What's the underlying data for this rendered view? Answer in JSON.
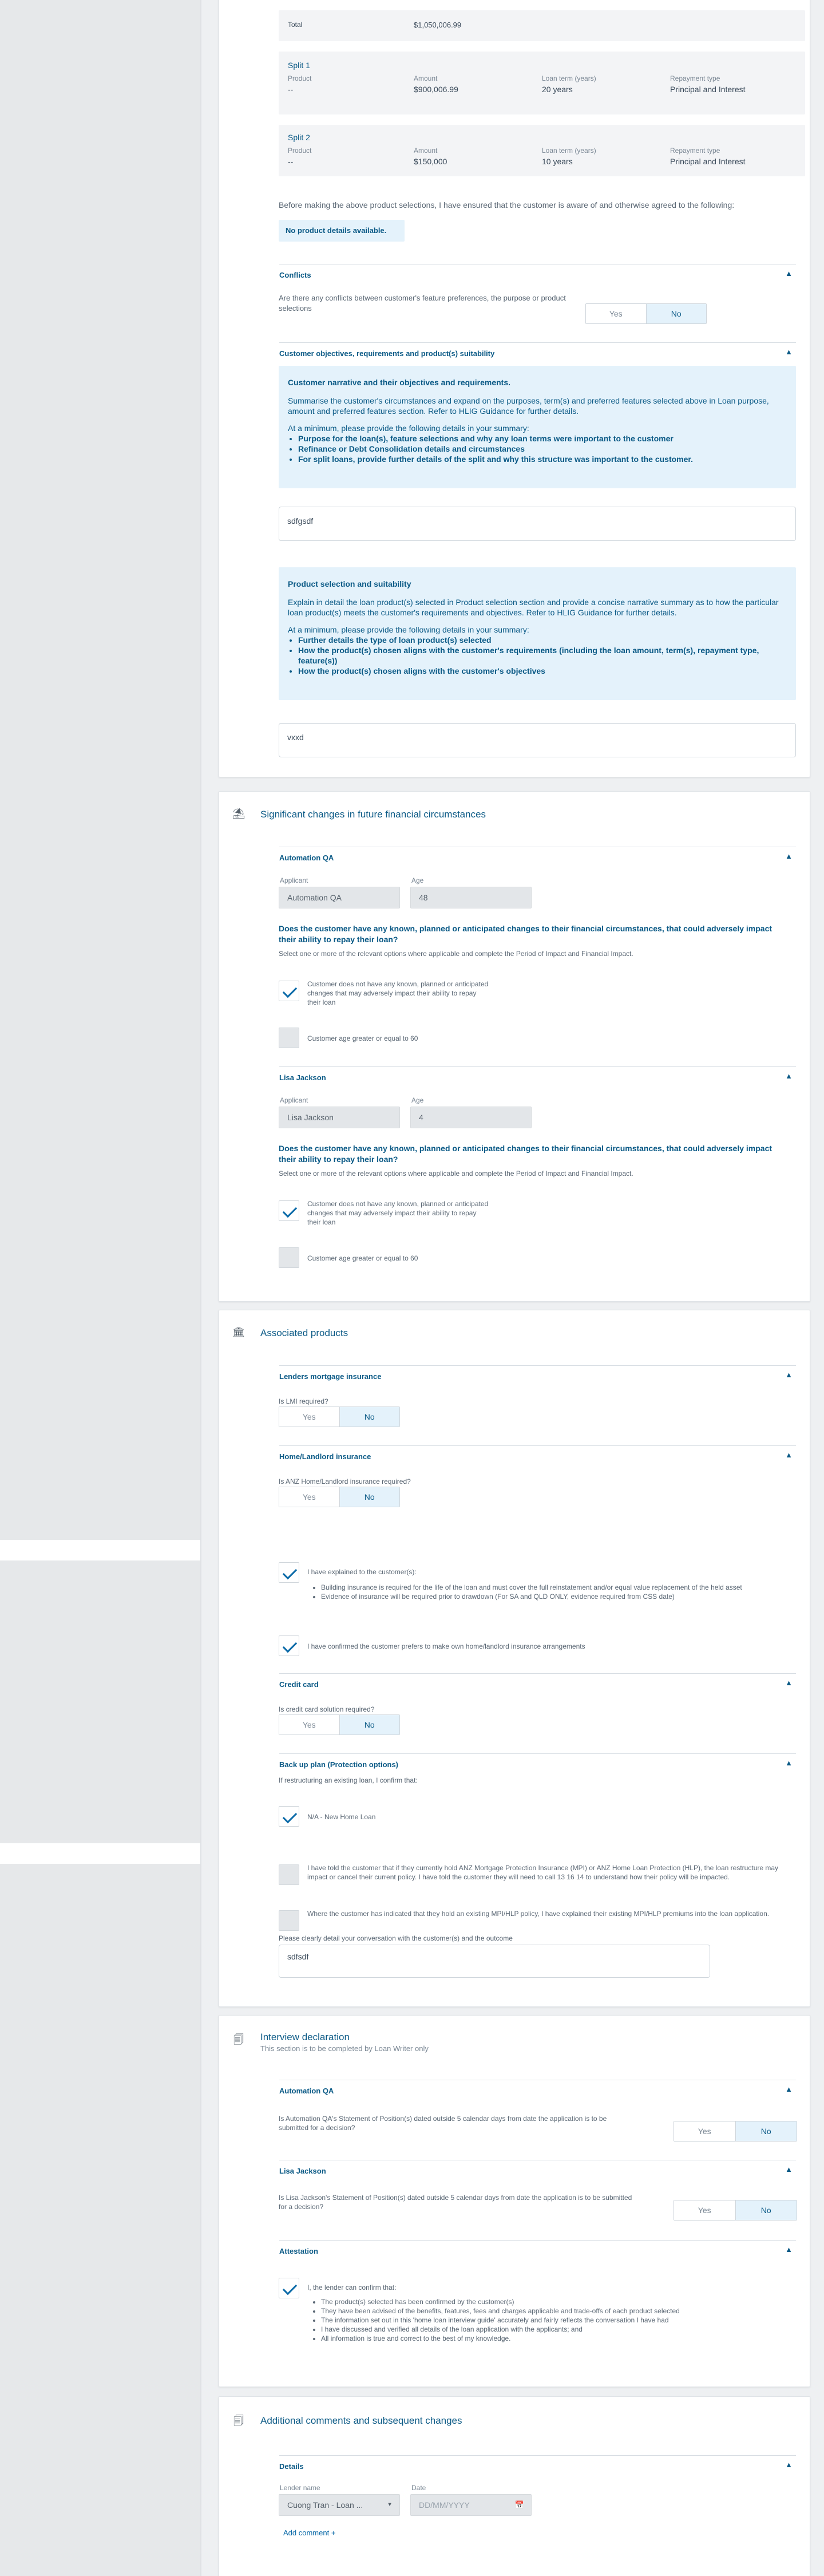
{
  "summary": {
    "total_label": "Total",
    "total_value": "$1,050,006.99",
    "splits": [
      {
        "title": "Split 1",
        "product_label": "Product",
        "product": "--",
        "amount_label": "Amount",
        "amount": "$900,006.99",
        "term_label": "Loan term (years)",
        "term": "20 years",
        "repayment_label": "Repayment type",
        "repayment": "Principal and Interest"
      },
      {
        "title": "Split 2",
        "product_label": "Product",
        "product": "--",
        "amount_label": "Amount",
        "amount": "$150,000",
        "term_label": "Loan term (years)",
        "term": "10 years",
        "repayment_label": "Repayment type",
        "repayment": "Principal and Interest"
      }
    ],
    "before_text": "Before making the above product selections, I have ensured that the customer is aware of and otherwise agreed to the following:",
    "no_details": "No product details available."
  },
  "conflicts": {
    "title": "Conflicts",
    "question": "Are there any conflicts between customer's feature preferences, the purpose or product selections",
    "yes": "Yes",
    "no": "No"
  },
  "objectives": {
    "title": "Customer objectives, requirements and product(s) suitability",
    "box1_title": "Customer narrative and their objectives and requirements.",
    "box1_para": "Summarise the customer's circumstances and expand on the purposes, term(s) and preferred features selected above in Loan purpose, amount and preferred features section. Refer to HLIG Guidance for further details.",
    "box1_min": "At a minimum, please provide the following details in your summary:",
    "box1_items": [
      "Purpose for the loan(s), feature selections and why any loan terms were important to the customer",
      "Refinance or Debt Consolidation details and circumstances",
      "For split loans, provide further details of the split and why this structure was important to the customer."
    ],
    "narrative_value": "sdfgsdf",
    "box2_title": "Product selection and suitability",
    "box2_para": "Explain in detail the loan product(s) selected in Product selection section and provide a concise narrative summary as to how the particular loan product(s) meets the customer's requirements and objectives. Refer to HLIG Guidance for further details.",
    "box2_min": "At a minimum, please provide the following details in your summary:",
    "box2_items": [
      "Further details the type of loan product(s) selected",
      "How the product(s) chosen aligns with the customer's requirements (including the loan amount, term(s), repayment type, feature(s))",
      "How the product(s) chosen aligns with the customer's objectives"
    ],
    "suitability_value": "vxxd"
  },
  "significant": {
    "title": "Significant changes in future financial circumstances",
    "applicants": [
      {
        "title": "Automation QA",
        "applicant_label": "Applicant",
        "applicant": "Automation QA",
        "age_label": "Age",
        "age": "48"
      },
      {
        "title": "Lisa Jackson",
        "applicant_label": "Applicant",
        "applicant": "Lisa Jackson",
        "age_label": "Age",
        "age": "4"
      }
    ],
    "question": "Does the customer have any known, planned or anticipated changes to their financial circumstances, that could adversely impact their ability to repay their loan?",
    "instruction": "Select one or more of the relevant options where applicable and complete the Period of Impact and Financial Impact.",
    "option_none": "Customer does not have any known, planned or anticipated changes that may adversely impact their ability to repay their loan",
    "option_age": "Customer age greater or equal to 60"
  },
  "associated": {
    "title": "Associated products",
    "lmi_title": "Lenders mortgage insurance",
    "lmi_q": "Is LMI required?",
    "home_title": "Home/Landlord insurance",
    "home_q": "Is ANZ Home/Landlord insurance required?",
    "explained": "I have explained to the customer(s):",
    "explained_items": [
      "Building insurance is required for the life of the loan and must cover the full reinstatement and/or equal value replacement of the held asset",
      "Evidence of insurance will be required prior to drawdown (For SA and QLD ONLY, evidence required from CSS date)"
    ],
    "confirmed": "I have confirmed the customer prefers to make own home/landlord insurance arrangements",
    "cc_title": "Credit card",
    "cc_q": "Is credit card solution required?",
    "backup_title": "Back up plan (Protection options)",
    "backup_q": "If restructuring an existing loan, I confirm that:",
    "na_option": "N/A - New Home Loan",
    "told_option": "I have told the customer that if they currently hold ANZ Mortgage Protection Insurance (MPI) or ANZ Home Loan Protection (HLP), the loan restructure may impact or cancel their current policy. I have told the customer they will need to call 13 16 14 to understand how their policy will be impacted.",
    "where_option": "Where the customer has indicated that they hold an existing MPI/HLP policy, I have explained their existing MPI/HLP premiums into the loan application.",
    "detail_label": "Please clearly detail your conversation with the customer(s) and the outcome",
    "detail_value": "sdfsdf",
    "yes": "Yes",
    "no": "No"
  },
  "interview": {
    "title": "Interview declaration",
    "subtitle": "This section is to be completed by Loan Writer only",
    "applicants": [
      {
        "title": "Automation QA",
        "question": "Is Automation QA's Statement of Position(s) dated outside 5 calendar days from date the application is to be submitted for a decision?"
      },
      {
        "title": "Lisa Jackson",
        "question": "Is Lisa Jackson's Statement of Position(s) dated outside 5 calendar days from date the application is to be submitted for a decision?"
      }
    ],
    "attestation_title": "Attestation",
    "attestation_confirm": "I, the lender can confirm that:",
    "attestation_items": [
      "The product(s) selected has been confirmed by the customer(s)",
      "They have been advised of the benefits, features, fees and charges applicable and trade-offs of each product selected",
      "The information set out in this 'home loan interview guide' accurately and fairly reflects the conversation I have had",
      "I have discussed and verified all details of the loan application with the applicants; and",
      "All information is true and correct to the best of my knowledge."
    ],
    "yes": "Yes",
    "no": "No"
  },
  "additional": {
    "title": "Additional comments and subsequent changes",
    "details_title": "Details",
    "lender_label": "Lender name",
    "lender_value": "Cuong Tran - Loan ...",
    "date_label": "Date",
    "date_placeholder": "DD/MM/YYYY",
    "add_comment": "Add comment"
  }
}
